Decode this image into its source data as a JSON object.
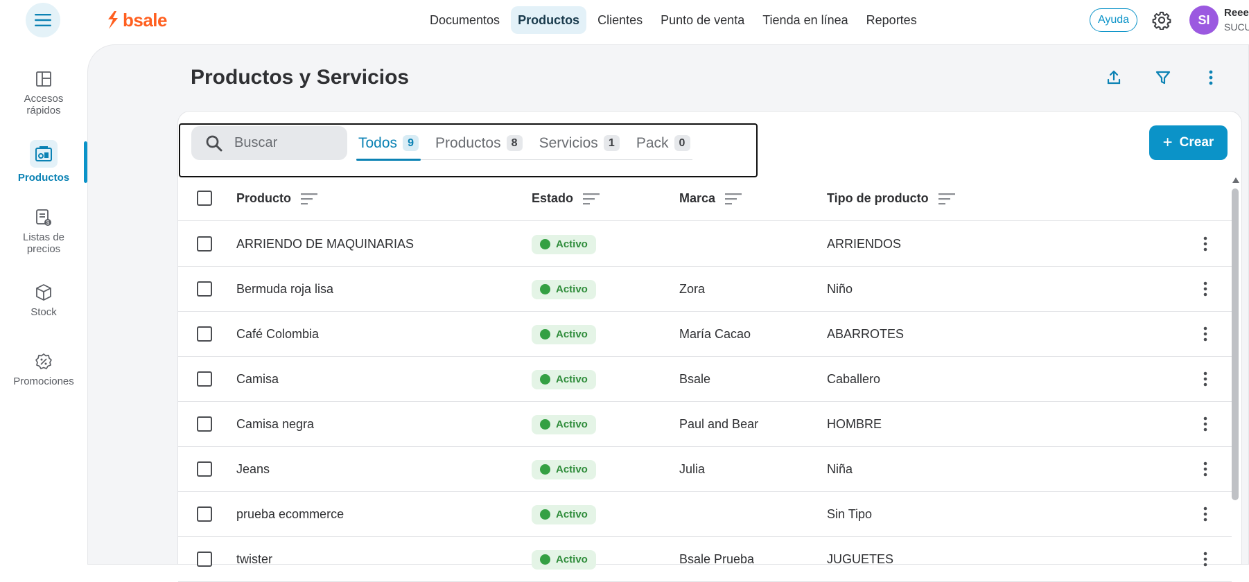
{
  "header": {
    "brand": "bsale",
    "nav": [
      {
        "label": "Documentos",
        "active": false
      },
      {
        "label": "Productos",
        "active": true
      },
      {
        "label": "Clientes",
        "active": false
      },
      {
        "label": "Punto de venta",
        "active": false
      },
      {
        "label": "Tienda en línea",
        "active": false
      },
      {
        "label": "Reportes",
        "active": false
      }
    ],
    "help_label": "Ayuda",
    "avatar_initials": "SI",
    "user_name": "Reee",
    "user_branch": "SUCU",
    "avatar_color": "#9b59e0"
  },
  "sidebar": {
    "items": [
      {
        "label_line1": "Accesos",
        "label_line2": "rápidos",
        "icon": "layout-icon",
        "active": false
      },
      {
        "label_line1": "Productos",
        "label_line2": "",
        "icon": "products-icon",
        "active": true
      },
      {
        "label_line1": "Listas de",
        "label_line2": "precios",
        "icon": "price-list-icon",
        "active": false
      },
      {
        "label_line1": "Stock",
        "label_line2": "",
        "icon": "box-icon",
        "active": false
      },
      {
        "label_line1": "Promociones",
        "label_line2": "",
        "icon": "promo-badge-icon",
        "active": false
      }
    ]
  },
  "page": {
    "title": "Productos y Servicios"
  },
  "search": {
    "placeholder": "Buscar"
  },
  "tabs": [
    {
      "label": "Todos",
      "count": "9",
      "active": true
    },
    {
      "label": "Productos",
      "count": "8",
      "active": false
    },
    {
      "label": "Servicios",
      "count": "1",
      "active": false
    },
    {
      "label": "Pack",
      "count": "0",
      "active": false
    }
  ],
  "create_label": "Crear",
  "table": {
    "columns": [
      "Producto",
      "Estado",
      "Marca",
      "Tipo de producto"
    ],
    "rows": [
      {
        "producto": "ARRIENDO DE MAQUINARIAS",
        "estado": "Activo",
        "marca": "",
        "tipo": "ARRIENDOS"
      },
      {
        "producto": "Bermuda roja lisa",
        "estado": "Activo",
        "marca": "Zora",
        "tipo": "Niño"
      },
      {
        "producto": "Café Colombia",
        "estado": "Activo",
        "marca": "María Cacao",
        "tipo": "ABARROTES"
      },
      {
        "producto": "Camisa",
        "estado": "Activo",
        "marca": "Bsale",
        "tipo": "Caballero"
      },
      {
        "producto": "Camisa negra",
        "estado": "Activo",
        "marca": "Paul and Bear",
        "tipo": "HOMBRE"
      },
      {
        "producto": "Jeans",
        "estado": "Activo",
        "marca": "Julia",
        "tipo": "Niña"
      },
      {
        "producto": "prueba ecommerce",
        "estado": "Activo",
        "marca": "",
        "tipo": "Sin Tipo"
      },
      {
        "producto": "twister",
        "estado": "Activo",
        "marca": "Bsale Prueba",
        "tipo": "JUGUETES"
      }
    ]
  },
  "colors": {
    "accent": "#0b93c8",
    "brand": "#ff5f1f",
    "status_active_bg": "#e4f4e6",
    "status_active_text": "#2e8c3a"
  }
}
